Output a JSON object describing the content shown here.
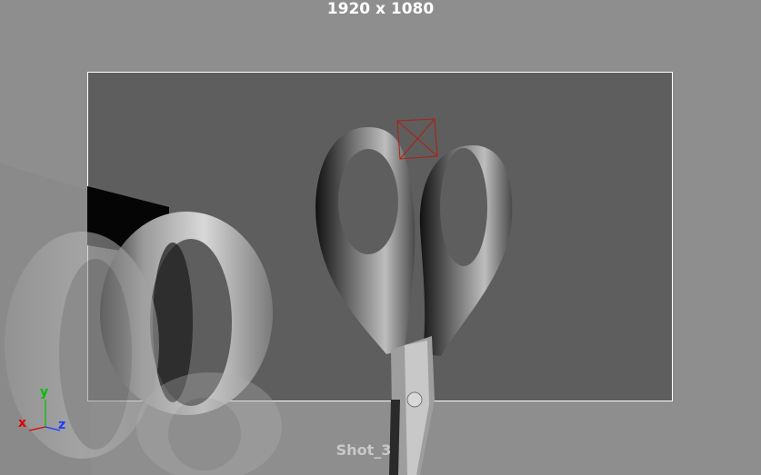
{
  "viewport": {
    "resolution_label": "1920 x 1080",
    "camera_name": "Shot_3"
  },
  "axis_gizmo": {
    "x_label": "x",
    "y_label": "y",
    "z_label": "z"
  },
  "colors": {
    "background": "#8e8e8e",
    "resolution_gate_fill": "#5e5e5e",
    "resolution_gate_border": "#ffffff",
    "selection_locator": "#b02010",
    "axis_x": "#e00000",
    "axis_y": "#00c000",
    "axis_z": "#1a3cff"
  }
}
